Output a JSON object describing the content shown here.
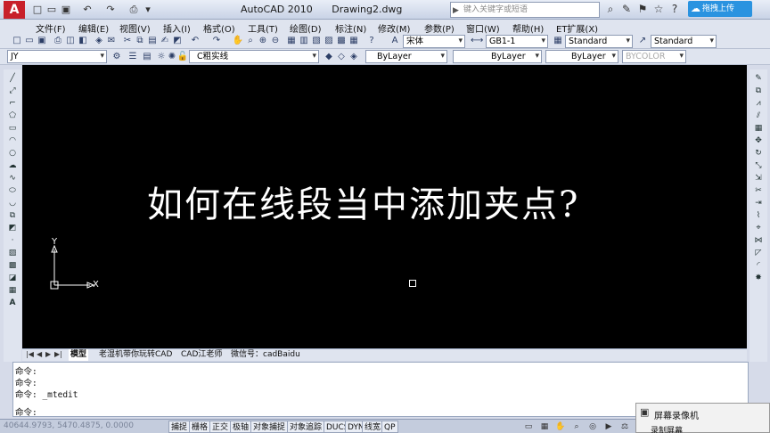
{
  "window": {
    "app_name": "AutoCAD 2010",
    "document": "Drawing2.dwg",
    "search_placeholder": "键入关键字或短语",
    "cloud_label": "拖拽上传"
  },
  "menu": [
    "文件(F)",
    "编辑(E)",
    "视图(V)",
    "插入(I)",
    "格式(O)",
    "工具(T)",
    "绘图(D)",
    "标注(N)",
    "修改(M)",
    "参数(P)",
    "窗口(W)",
    "帮助(H)",
    "ET扩展(X)"
  ],
  "styles": {
    "text_font": "宋体",
    "dim_style": "GB1-1",
    "table_style": "Standard",
    "multileader_style": "Standard"
  },
  "layers": {
    "current_layer": "JY",
    "layer_state": "C粗实线",
    "color": "ByLayer",
    "linetype": "ByLayer",
    "lineweight": "ByLayer",
    "plot_style": "BYCOLOR"
  },
  "canvas": {
    "title": "如何在线段当中添加夹点?",
    "ucs_x": "X",
    "ucs_y": "Y"
  },
  "tabs": {
    "nav": [
      "|◀",
      "◀",
      "▶",
      "▶|"
    ],
    "items": [
      "模型",
      "老湿机带你玩转CAD",
      "CAD江老师",
      "微信号：cadBaidu"
    ]
  },
  "command": {
    "lines": [
      "命令:",
      "命令:",
      "命令: _mtedit"
    ],
    "prompt": "命令:"
  },
  "status": {
    "coords": "40644.9793, 5470.4875, 0.0000",
    "toggles": [
      "捕捉",
      "栅格",
      "正交",
      "极轴",
      "对象捕捉",
      "对象追踪",
      "DUCS",
      "DYN",
      "线宽",
      "QP"
    ]
  },
  "recorder": {
    "title": "屏幕录像机",
    "subtitle": "录制屏幕"
  },
  "colors": {
    "canvas_bg": "#000000",
    "ui_bg": "#dfe4ef",
    "logo_red": "#c8202a",
    "cloud_blue": "#2a93e0"
  }
}
